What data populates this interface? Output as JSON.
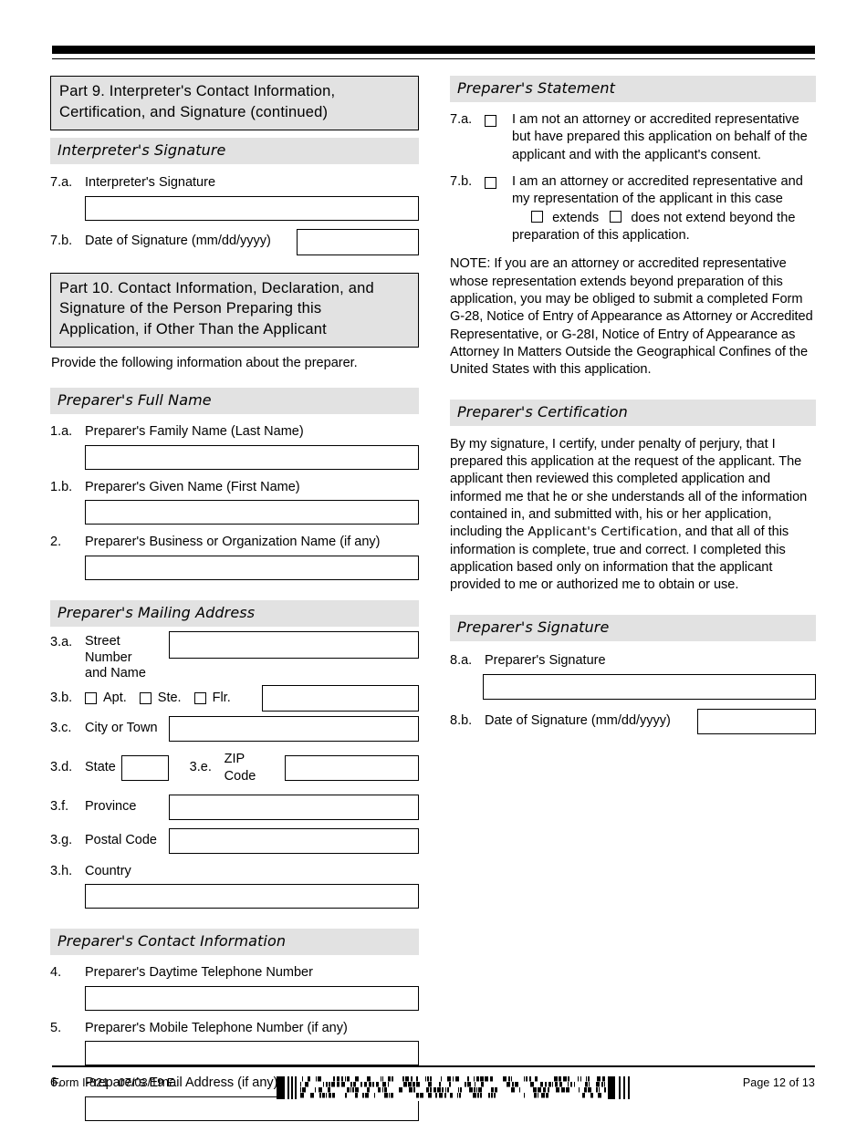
{
  "document": {
    "form_number": "Form I-821",
    "edition_date": "07/03/19 E",
    "page_label": "Page 12 of 13",
    "barcode_name": "pdf417-barcode"
  },
  "left_column": {
    "part9": {
      "header_line1": "Part 9.  Interpreter's Contact Information,",
      "header_line2": "Certification, and Signature (continued)",
      "section_signature": "Interpreter's Signature",
      "item_7a_num": "7.a.",
      "item_7a_label": "Interpreter's Signature",
      "item_7b_num": "7.b.",
      "item_7b_label": "Date of Signature (mm/dd/yyyy)"
    },
    "part10": {
      "header_line1": "Part 10.  Contact Information, Declaration, and",
      "header_line2": "Signature of the Person Preparing this",
      "header_line3": "Application, if Other Than the Applicant",
      "intro": "Provide the following information about the preparer.",
      "section_full_name": "Preparer's Full Name",
      "item_1a_num": "1.a.",
      "item_1a_label": "Preparer's Family Name (Last Name)",
      "item_1b_num": "1.b.",
      "item_1b_label": "Preparer's Given Name (First Name)",
      "item_2_num": "2.",
      "item_2_label": "Preparer's Business or Organization Name (if any)",
      "section_mailing_address": "Preparer's Mailing Address",
      "item_3a_num": "3.a.",
      "item_3a_label_line1": "Street Number",
      "item_3a_label_line2": "and Name",
      "item_3b_num": "3.b.",
      "item_3b_opt1": "Apt.",
      "item_3b_opt2": "Ste.",
      "item_3b_opt3": "Flr.",
      "item_3c_num": "3.c.",
      "item_3c_label": "City or Town",
      "item_3d_num": "3.d.",
      "item_3d_label": "State",
      "item_3e_num": "3.e.",
      "item_3e_label": "ZIP Code",
      "item_3f_num": "3.f.",
      "item_3f_label": "Province",
      "item_3g_num": "3.g.",
      "item_3g_label": "Postal Code",
      "item_3h_num": "3.h.",
      "item_3h_label": "Country",
      "section_contact_info": "Preparer's Contact Information",
      "item_4_num": "4.",
      "item_4_label": "Preparer's Daytime Telephone Number",
      "item_5_num": "5.",
      "item_5_label": "Preparer's Mobile Telephone Number (if any)",
      "item_6_num": "6.",
      "item_6_label": "Preparer's Email Address (if any)"
    }
  },
  "right_column": {
    "statement": {
      "section_title": "Preparer's Statement",
      "item_7a_num": "7.a.",
      "item_7a_text": "I am not an attorney or accredited representative but have prepared this application on behalf of the applicant and with the applicant's consent.",
      "item_7b_num": "7.b.",
      "item_7b_text_line1": "I am an attorney or accredited representative and my representation of the applicant in this case",
      "item_7b_opt_extends": "extends",
      "item_7b_opt_not_extends": "does not extend beyond the",
      "item_7b_text_tail": "preparation of this application.",
      "note_text": "NOTE:  If you are an attorney or accredited representative whose representation extends beyond preparation of this application, you may be obliged to submit a completed Form G-28, Notice of Entry of Appearance as Attorney or Accredited Representative, or G-28I, Notice of Entry of Appearance as Attorney In Matters Outside the Geographical Confines of the United States with this application."
    },
    "certification": {
      "section_title": "Preparer's Certification",
      "text_part1": "By my signature, I certify, under penalty of perjury, that I prepared this application at the request of the applicant.  The applicant then reviewed this completed application and informed me that he or she understands all of the information contained in, and submitted with, his or her application, including the ",
      "emphasis": "Applicant's Certification",
      "text_part2": ", and that all of this information is complete, true and correct.  I completed this application based only on information that the applicant provided to me or authorized me to obtain or use."
    },
    "signature": {
      "section_title": "Preparer's Signature",
      "item_8a_num": "8.a.",
      "item_8a_label": "Preparer's Signature",
      "item_8b_num": "8.b.",
      "item_8b_label": "Date of Signature (mm/dd/yyyy)"
    }
  }
}
